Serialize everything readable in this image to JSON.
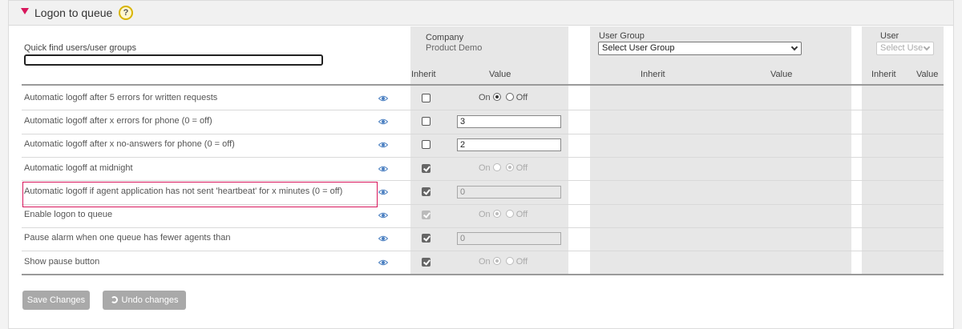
{
  "section": {
    "title": "Logon to queue",
    "help": "?"
  },
  "quick_find": {
    "label": "Quick find users/user groups",
    "value": ""
  },
  "company": {
    "title": "Company",
    "name": "Product Demo",
    "inherit": "Inherit",
    "value": "Value"
  },
  "user_group": {
    "title": "User Group",
    "select": "Select User Group",
    "inherit": "Inherit",
    "value": "Value"
  },
  "user": {
    "title": "User",
    "select": "Select Use",
    "inherit": "Inherit",
    "value": "Value"
  },
  "rows": [
    {
      "label": "Automatic logoff after 5 errors for written requests",
      "type": "radio",
      "inherit": false,
      "on": "On",
      "off": "Off",
      "selected": "on",
      "disabled": false
    },
    {
      "label": "Automatic logoff after x errors for phone (0 = off)",
      "type": "number",
      "inherit": false,
      "value": "3",
      "disabled": false
    },
    {
      "label": "Automatic logoff after x no-answers for phone (0 = off)",
      "type": "number",
      "inherit": false,
      "value": "2",
      "disabled": false
    },
    {
      "label": "Automatic logoff at midnight",
      "type": "radio",
      "inherit": true,
      "on": "On",
      "off": "Off",
      "selected": "off",
      "disabled": true
    },
    {
      "label": "Automatic logoff if agent application has not sent 'heartbeat' for x minutes (0 = off)",
      "type": "number",
      "inherit": true,
      "value": "0",
      "disabled": true,
      "highlighted": true
    },
    {
      "label": "Enable logon to queue",
      "type": "radio",
      "inherit": true,
      "on": "On",
      "off": "Off",
      "selected": "on",
      "disabled": true,
      "checkbox_dim": true
    },
    {
      "label": "Pause alarm when one queue has fewer agents than",
      "type": "number",
      "inherit": true,
      "value": "0",
      "disabled": true
    },
    {
      "label": "Show pause button",
      "type": "radio",
      "inherit": true,
      "on": "On",
      "off": "Off",
      "selected": "on",
      "disabled": true
    }
  ],
  "buttons": {
    "save": "Save Changes",
    "undo": "Undo changes"
  },
  "colors": {
    "accent": "#d8175c",
    "column_bg": "#e7e7e7",
    "button": "#a9a9a9"
  }
}
